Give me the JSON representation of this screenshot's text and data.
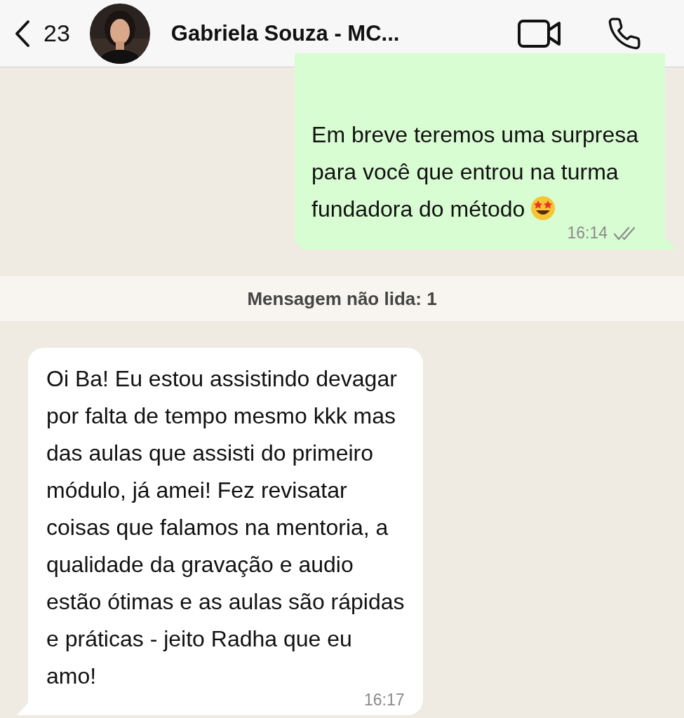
{
  "header": {
    "back_count": "23",
    "contact_name": "Gabriela Souza - MC..."
  },
  "messages": [
    {
      "kind": "outgoing",
      "text": "Em breve teremos uma surpresa\npara você que entrou na turma\nfundadora do método",
      "emoji": true,
      "time": "16:14",
      "read": false
    },
    {
      "kind": "unread_banner",
      "text": "Mensagem não lida: 1"
    },
    {
      "kind": "incoming",
      "text": "Oi Ba! Eu estou assistindo devagar\npor falta de tempo mesmo kkk mas\ndas aulas que assisti do primeiro\nmódulo, já amei! Fez revisatar\ncoisas que falamos na mentoria, a\nqualidade da gravação e audio\nestão ótimas e as aulas são rápidas\ne práticas - jeito Radha que eu\namo!",
      "emoji": false,
      "time": "16:17"
    }
  ]
}
